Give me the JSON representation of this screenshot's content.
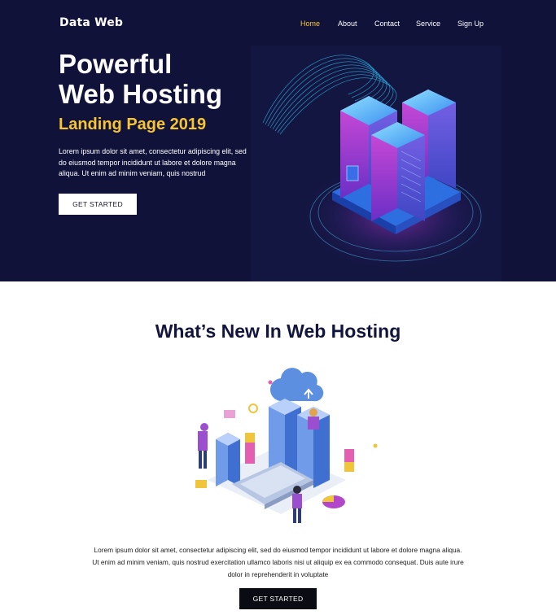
{
  "brand": {
    "logo_text": "Data Web"
  },
  "nav": {
    "items": [
      {
        "label": "Home",
        "active": true
      },
      {
        "label": "About",
        "active": false
      },
      {
        "label": "Contact",
        "active": false
      },
      {
        "label": "Service",
        "active": false
      },
      {
        "label": "Sign Up",
        "active": false
      }
    ]
  },
  "hero": {
    "title_line1": "Powerful",
    "title_line2": "Web Hosting",
    "subtitle": "Landing Page 2019",
    "description": "Lorem ipsum dolor sit amet, consectetur adipiscing elit, sed do eiusmod tempor incididunt ut labore et dolore magna aliqua. Ut enim ad minim veniam, quis nostrud",
    "cta_label": "GET STARTED",
    "illustration_icon": "server-rack-icon"
  },
  "features": {
    "title": "What’s New In Web Hosting",
    "illustration_icon": "cloud-server-icon",
    "description": "Lorem ipsum dolor sit amet, consectetur adipiscing elit, sed do eiusmod tempor incididunt ut labore et dolore magna aliqua. Ut enim ad minim veniam, quis nostrud exercitation ullamco laboris nisi ut aliquip ex ea commodo consequat. Duis aute irure dolor in reprehenderit in voluptate",
    "cta_label": "GET STARTED"
  },
  "colors": {
    "hero_bg": "#10123a",
    "accent_yellow": "#f7c531",
    "title_navy": "#12153d",
    "button_dark": "#0b0b14"
  }
}
